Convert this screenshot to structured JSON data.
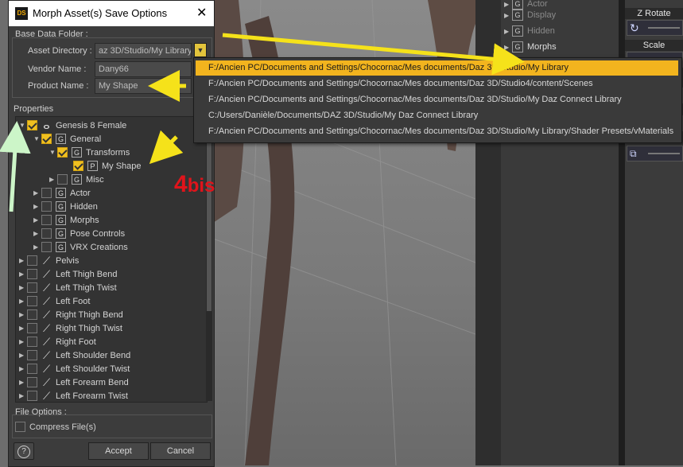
{
  "dialog": {
    "title": "Morph Asset(s) Save Options",
    "logo_text": "DS",
    "close_glyph": "✕",
    "base_group_label": "Base Data Folder :",
    "asset_directory_label": "Asset Directory :",
    "asset_directory_value": "az 3D/Studio/My Library",
    "vendor_label": "Vendor Name :",
    "vendor_value": "Dany66",
    "product_label": "Product Name :",
    "product_value": "My Shape",
    "properties_label": "Properties",
    "file_options_label": "File Options :",
    "compress_label": "Compress File(s)",
    "help_glyph": "?",
    "accept_label": "Accept",
    "cancel_label": "Cancel"
  },
  "tree": [
    {
      "label": "Genesis 8 Female",
      "icon": "figure-icon",
      "icon_glyph": "ⴰ",
      "expanded": true,
      "checked": true,
      "indent": 0
    },
    {
      "label": "General",
      "icon": "group-icon",
      "icon_glyph": "G",
      "expanded": true,
      "checked": true,
      "indent": 1
    },
    {
      "label": "Transforms",
      "icon": "group-icon",
      "icon_glyph": "G",
      "expanded": true,
      "checked": true,
      "indent": 2
    },
    {
      "label": "My Shape",
      "icon": "property-icon",
      "icon_glyph": "P",
      "expanded": null,
      "checked": true,
      "indent": 3
    },
    {
      "label": "Misc",
      "icon": "group-icon",
      "icon_glyph": "G",
      "expanded": false,
      "checked": false,
      "indent": 2
    },
    {
      "label": "Actor",
      "icon": "group-icon",
      "icon_glyph": "G",
      "expanded": false,
      "checked": false,
      "indent": 1
    },
    {
      "label": "Hidden",
      "icon": "group-icon",
      "icon_glyph": "G",
      "expanded": false,
      "checked": false,
      "indent": 1
    },
    {
      "label": "Morphs",
      "icon": "group-icon",
      "icon_glyph": "G",
      "expanded": false,
      "checked": false,
      "indent": 1
    },
    {
      "label": "Pose Controls",
      "icon": "group-icon",
      "icon_glyph": "G",
      "expanded": false,
      "checked": false,
      "indent": 1
    },
    {
      "label": "VRX Creations",
      "icon": "group-icon",
      "icon_glyph": "G",
      "expanded": false,
      "checked": false,
      "indent": 1
    },
    {
      "label": "Pelvis",
      "icon": "bone-icon",
      "icon_glyph": "⟋",
      "expanded": false,
      "checked": false,
      "indent": 0
    },
    {
      "label": "Left Thigh Bend",
      "icon": "bone-icon",
      "icon_glyph": "⟋",
      "expanded": false,
      "checked": false,
      "indent": 0
    },
    {
      "label": "Left Thigh Twist",
      "icon": "bone-icon",
      "icon_glyph": "⟋",
      "expanded": false,
      "checked": false,
      "indent": 0
    },
    {
      "label": "Left Foot",
      "icon": "bone-icon",
      "icon_glyph": "⟋",
      "expanded": false,
      "checked": false,
      "indent": 0
    },
    {
      "label": "Right Thigh Bend",
      "icon": "bone-icon",
      "icon_glyph": "⟋",
      "expanded": false,
      "checked": false,
      "indent": 0
    },
    {
      "label": "Right Thigh Twist",
      "icon": "bone-icon",
      "icon_glyph": "⟋",
      "expanded": false,
      "checked": false,
      "indent": 0
    },
    {
      "label": "Right Foot",
      "icon": "bone-icon",
      "icon_glyph": "⟋",
      "expanded": false,
      "checked": false,
      "indent": 0
    },
    {
      "label": "Left Shoulder Bend",
      "icon": "bone-icon",
      "icon_glyph": "⟋",
      "expanded": false,
      "checked": false,
      "indent": 0
    },
    {
      "label": "Left Shoulder Twist",
      "icon": "bone-icon",
      "icon_glyph": "⟋",
      "expanded": false,
      "checked": false,
      "indent": 0
    },
    {
      "label": "Left Forearm Bend",
      "icon": "bone-icon",
      "icon_glyph": "⟋",
      "expanded": false,
      "checked": false,
      "indent": 0
    },
    {
      "label": "Left Forearm Twist",
      "icon": "bone-icon",
      "icon_glyph": "⟋",
      "expanded": false,
      "checked": false,
      "indent": 0
    }
  ],
  "dropdown": {
    "items": [
      {
        "label": "F:/Ancien PC/Documents and Settings/Chocornac/Mes documents/Daz 3D/Studio/My Library",
        "selected": true
      },
      {
        "label": "F:/Ancien PC/Documents and Settings/Chocornac/Mes documents/Daz 3D/Studio4/content/Scenes",
        "selected": false
      },
      {
        "label": "F:/Ancien PC/Documents and Settings/Chocornac/Mes documents/Daz 3D/Studio/My Daz Connect Library",
        "selected": false
      },
      {
        "label": "C:/Users/Danièle/Documents/DAZ 3D/Studio/My Daz Connect Library",
        "selected": false
      },
      {
        "label": "F:/Ancien PC/Documents and Settings/Chocornac/Mes documents/Daz 3D/Studio/My Library/Shader Presets/vMaterials",
        "selected": false
      }
    ]
  },
  "right_panel": {
    "items": [
      {
        "label": "Actor",
        "icon_glyph": "G"
      },
      {
        "label": "Display",
        "icon_glyph": "G"
      },
      {
        "label": "Hidden",
        "icon_glyph": "G"
      },
      {
        "label": "Morphs",
        "icon_glyph": "G"
      }
    ],
    "zrotate_label": "Z Rotate",
    "scale_label": "Scale"
  },
  "annotation": {
    "main": "4",
    "suffix": "bis"
  },
  "colors": {
    "accent": "#f2b41e",
    "arrow_yellow": "#f5e21a",
    "arrow_green": "#ccf5c8",
    "annotation_red": "#e0141b"
  }
}
